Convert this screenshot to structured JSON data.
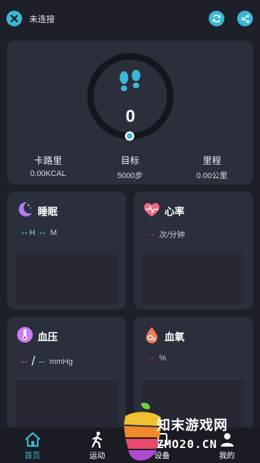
{
  "header": {
    "status": "未连接"
  },
  "steps": {
    "value": "0"
  },
  "stats": [
    {
      "label": "卡路里",
      "value": "0.00KCAL"
    },
    {
      "label": "目标",
      "value": "5000步"
    },
    {
      "label": "里程",
      "value": "0.00公里"
    }
  ],
  "sleep": {
    "title": "睡眠",
    "hour_dash": "--",
    "hour_unit": "H",
    "min_dash": "--",
    "min_unit": "M"
  },
  "heart": {
    "title": "心率",
    "dash": "--",
    "unit": "次/分钟"
  },
  "bp": {
    "title": "血压",
    "sys_dash": "--",
    "sep": "/",
    "dia_dash": "--",
    "unit": "mmHg"
  },
  "oxygen": {
    "title": "血氧",
    "dash": "--",
    "unit": "%"
  },
  "tabs": [
    {
      "label": "首页",
      "icon": "home-icon"
    },
    {
      "label": "运动",
      "icon": "running-icon"
    },
    {
      "label": "设备",
      "icon": "device-icon"
    },
    {
      "label": "我的",
      "icon": "user-icon"
    }
  ],
  "watermark": {
    "cn": "知末游戏网",
    "en": "ZMO20.CN"
  },
  "colors": {
    "accent": "#3ab7d6",
    "cyan_dash": "#3ad9e6",
    "red_dash": "#c4343c",
    "pink_dash": "#d94fe0"
  }
}
